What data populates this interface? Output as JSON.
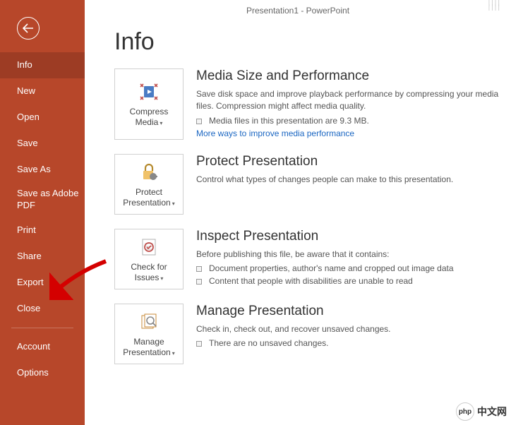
{
  "window_title": "Presentation1 - PowerPoint",
  "page_title": "Info",
  "nav": {
    "items": [
      {
        "label": "Info",
        "active": true
      },
      {
        "label": "New"
      },
      {
        "label": "Open"
      },
      {
        "label": "Save"
      },
      {
        "label": "Save As"
      },
      {
        "label": "Save as Adobe PDF",
        "multiline": true
      },
      {
        "label": "Print"
      },
      {
        "label": "Share"
      },
      {
        "label": "Export"
      },
      {
        "label": "Close"
      }
    ],
    "footer": [
      {
        "label": "Account"
      },
      {
        "label": "Options"
      }
    ]
  },
  "sections": {
    "media": {
      "button_label": "Compress Media",
      "heading": "Media Size and Performance",
      "desc": "Save disk space and improve playback performance by compressing your media files. Compression might affect media quality.",
      "bullet1": "Media files in this presentation are 9.3 MB.",
      "link": "More ways to improve media performance"
    },
    "protect": {
      "button_label": "Protect Presentation",
      "heading": "Protect Presentation",
      "desc": "Control what types of changes people can make to this presentation."
    },
    "inspect": {
      "button_label": "Check for Issues",
      "heading": "Inspect Presentation",
      "desc": "Before publishing this file, be aware that it contains:",
      "bullet1": "Document properties, author's name and cropped out image data",
      "bullet2": "Content that people with disabilities are unable to read"
    },
    "manage": {
      "button_label": "Manage Presentation",
      "heading": "Manage Presentation",
      "desc": "Check in, check out, and recover unsaved changes.",
      "bullet1": "There are no unsaved changes."
    }
  },
  "watermark": {
    "logo": "php",
    "text": "中文网"
  }
}
